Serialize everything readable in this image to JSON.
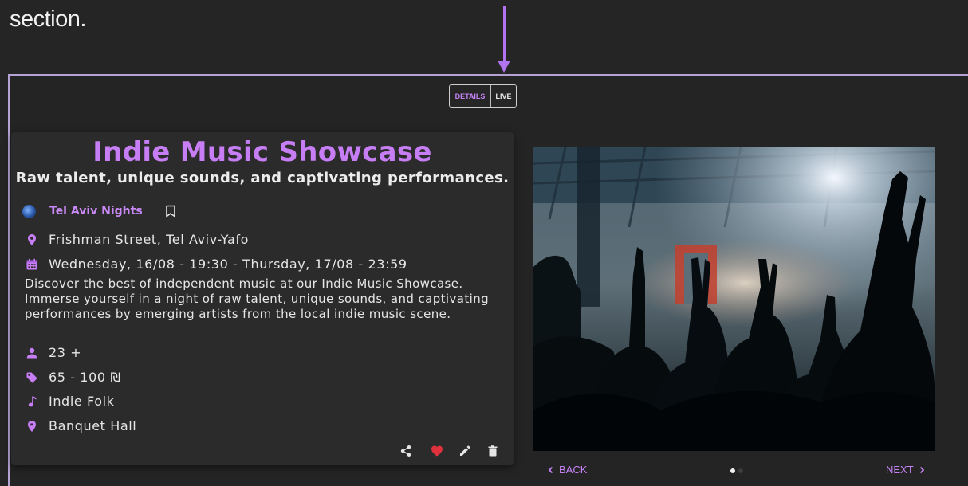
{
  "header": {
    "text": "section."
  },
  "view_toggle": {
    "details_label": "DETAILS",
    "live_label": "LIVE"
  },
  "event": {
    "title": "Indie Music Showcase",
    "subtitle": "Raw talent, unique sounds, and captivating performances.",
    "organizer": "Tel Aviv Nights",
    "location": "Frishman Street, Tel Aviv-Yafo",
    "datetime": "Wednesday, 16/08 - 19:30 - Thursday, 17/08 - 23:59",
    "description": "Discover the best of independent music at our Indie Music Showcase. Immerse yourself in a night of raw talent, unique sounds, and captivating performances by emerging artists from the local indie music scene.",
    "age": "23 +",
    "price": "65 - 100 ₪",
    "genres": "Indie  Folk",
    "venue_type": "Banquet Hall"
  },
  "colors": {
    "accent": "#c77ef5",
    "favorite": "#e0323c"
  },
  "gallery": {
    "back_label": "BACK",
    "next_label": "NEXT",
    "current_slide": 1,
    "total_slides": 2
  }
}
